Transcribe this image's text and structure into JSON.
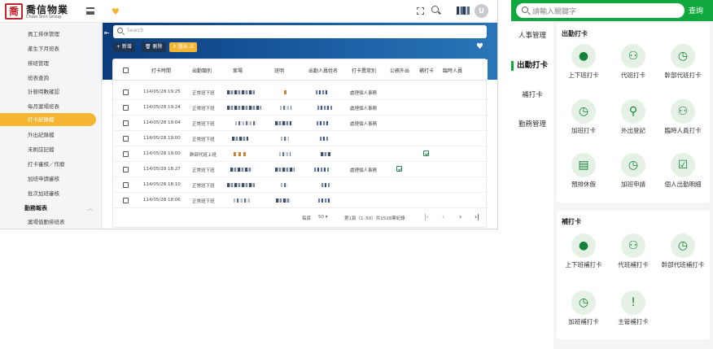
{
  "admin": {
    "logo_mark": "喬",
    "logo_title": "喬信物業",
    "logo_subtitle": "Chiao Shin Group",
    "avatar_letter": "U",
    "sidebar": {
      "items": [
        {
          "label": "員工排休管理"
        },
        {
          "label": "產生下月班表"
        },
        {
          "label": "排班管理"
        },
        {
          "label": "班表查詢"
        },
        {
          "label": "計薪時數確認"
        },
        {
          "label": "每月案場班表"
        },
        {
          "label": "打卡紀錄檔",
          "active": true
        },
        {
          "label": "外出紀錄檔"
        },
        {
          "label": "未刷註記檔"
        },
        {
          "label": "打卡審核／作廢"
        },
        {
          "label": "加班申請審核"
        },
        {
          "label": "批次加班審核"
        }
      ],
      "group_label": "勤務報表",
      "group_item": "案場值勤排班表"
    },
    "search_placeholder": "Search",
    "toolbar": {
      "add": "+ 新增",
      "delete": "🗑 刪除",
      "export": "⇞ 匯出 ☰"
    },
    "columns": [
      "打卡時間",
      "出勤類別",
      "案場",
      "班明",
      "出勤人員姓名",
      "打卡異常別",
      "公務外出",
      "補打卡",
      "臨時人員"
    ],
    "rows": [
      {
        "time": "114/05/28 19:25",
        "type": "正常班下班",
        "abnormal": "處理個人事務",
        "official_out": false
      },
      {
        "time": "114/05/28 19:24",
        "type": "正常班下班",
        "abnormal": "處理個人事務",
        "official_out": false
      },
      {
        "time": "114/05/28 19:04",
        "type": "正常班下班",
        "abnormal": "處理個人事務",
        "official_out": false
      },
      {
        "time": "114/05/28 19:00",
        "type": "正常班下班",
        "abnormal": "",
        "official_out": false
      },
      {
        "time": "114/05/28 19:00",
        "type": "幹部代班上班",
        "abnormal": "",
        "official_out": false,
        "makeup": true
      },
      {
        "time": "114/05/28 18:27",
        "type": "正常班下班",
        "abnormal": "處理個人事務",
        "official_out": true
      },
      {
        "time": "114/05/28 18:10",
        "type": "正常班下班",
        "abnormal": "",
        "official_out": false
      },
      {
        "time": "114/05/28 18:06",
        "type": "正常班下班",
        "abnormal": "",
        "official_out": false
      }
    ],
    "pager": {
      "per_page_label": "每頁",
      "per_page": "50 ▾",
      "range": "第1頁（1–50）共1528筆紀錄"
    }
  },
  "mobile": {
    "search_placeholder": "請輸入關鍵字",
    "search_button": "查詢",
    "nav": [
      {
        "label": "人事管理"
      },
      {
        "label": "出勤打卡",
        "active": true
      },
      {
        "label": "補打卡"
      },
      {
        "label": "勤務管理"
      }
    ],
    "sections": [
      {
        "title": "出勤打卡",
        "tiles": [
          {
            "label": "上下班打卡",
            "icon": "person-pin-icon"
          },
          {
            "label": "代班打卡",
            "icon": "people-icon"
          },
          {
            "label": "幹部代班打卡",
            "icon": "person-clock-icon"
          },
          {
            "label": "加班打卡",
            "icon": "person-clock-icon"
          },
          {
            "label": "外出登記",
            "icon": "walking-icon"
          },
          {
            "label": "臨時人員打卡",
            "icon": "people-icon"
          },
          {
            "label": "預排休假",
            "icon": "document-icon"
          },
          {
            "label": "加班申請",
            "icon": "person-clock-icon"
          },
          {
            "label": "個人出勤明細",
            "icon": "calendar-check-icon"
          }
        ]
      },
      {
        "title": "補打卡",
        "tiles": [
          {
            "label": "上下班補打卡",
            "icon": "person-pin-icon"
          },
          {
            "label": "代班補打卡",
            "icon": "people-icon"
          },
          {
            "label": "幹部代班補打卡",
            "icon": "person-clock-icon"
          },
          {
            "label": "加班補打卡",
            "icon": "person-clock-icon"
          },
          {
            "label": "主管補打卡",
            "icon": "person-alert-icon"
          }
        ]
      }
    ]
  },
  "colors": {
    "accent_yellow": "#f6b532",
    "brand_green": "#11a83d",
    "band_blue": "#1a5da4",
    "logo_red": "#c0272d"
  }
}
